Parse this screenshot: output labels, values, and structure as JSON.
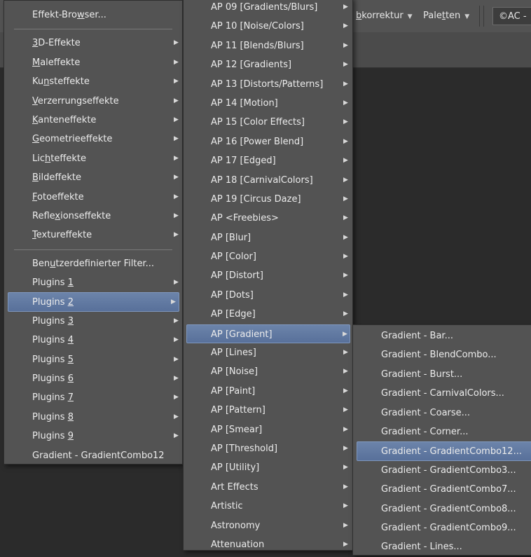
{
  "toolbar": {
    "farbkorrektur_prefix": "",
    "farbkorrektur_u": "b",
    "farbkorrektur_rest": "korrektur",
    "paletten_pre": "Pale",
    "paletten_u": "t",
    "paletten_rest": "ten",
    "copyright_box": "©AC -"
  },
  "menu1": {
    "items": [
      {
        "pre": "Effekt-Bro",
        "u": "w",
        "post": "ser...",
        "arrow": false
      },
      {
        "separator": true
      },
      {
        "pre": "",
        "u": "3",
        "post": "D-Effekte",
        "arrow": true
      },
      {
        "pre": "",
        "u": "M",
        "post": "aleffekte",
        "arrow": true
      },
      {
        "pre": "Ku",
        "u": "n",
        "post": "steffekte",
        "arrow": true
      },
      {
        "pre": "",
        "u": "V",
        "post": "erzerrungseffekte",
        "arrow": true
      },
      {
        "pre": "",
        "u": "K",
        "post": "anteneffekte",
        "arrow": true
      },
      {
        "pre": "",
        "u": "G",
        "post": "eometrieeffekte",
        "arrow": true
      },
      {
        "pre": "Lic",
        "u": "h",
        "post": "teffekte",
        "arrow": true
      },
      {
        "pre": "",
        "u": "B",
        "post": "ildeffekte",
        "arrow": true
      },
      {
        "pre": "",
        "u": "F",
        "post": "otoeffekte",
        "arrow": true
      },
      {
        "pre": "Refle",
        "u": "x",
        "post": "ionseffekte",
        "arrow": true
      },
      {
        "pre": "",
        "u": "T",
        "post": "extureffekte",
        "arrow": true
      },
      {
        "separator": true
      },
      {
        "pre": "Ben",
        "u": "u",
        "post": "tzerdefinierter Filter...",
        "arrow": false
      },
      {
        "pre": "Plugins ",
        "u": "1",
        "post": "",
        "arrow": true
      },
      {
        "pre": "Plugins ",
        "u": "2",
        "post": "",
        "arrow": true,
        "highlighted": true
      },
      {
        "pre": "Plugins ",
        "u": "3",
        "post": "",
        "arrow": true
      },
      {
        "pre": "Plugins ",
        "u": "4",
        "post": "",
        "arrow": true
      },
      {
        "pre": "Plugins ",
        "u": "5",
        "post": "",
        "arrow": true
      },
      {
        "pre": "Plugins ",
        "u": "6",
        "post": "",
        "arrow": true
      },
      {
        "pre": "Plugins ",
        "u": "7",
        "post": "",
        "arrow": true
      },
      {
        "pre": "Plugins ",
        "u": "8",
        "post": "",
        "arrow": true
      },
      {
        "pre": "Plugins ",
        "u": "9",
        "post": "",
        "arrow": true
      },
      {
        "pre": "Gradient - GradientCombo12",
        "u": "",
        "post": "",
        "arrow": false
      }
    ]
  },
  "menu2": {
    "items": [
      {
        "label": "AP 09 [Gradients/Blurs]",
        "arrow": true
      },
      {
        "label": "AP 10 [Noise/Colors]",
        "arrow": true
      },
      {
        "label": "AP 11 [Blends/Blurs]",
        "arrow": true
      },
      {
        "label": "AP 12 [Gradients]",
        "arrow": true
      },
      {
        "label": "AP 13 [Distorts/Patterns]",
        "arrow": true
      },
      {
        "label": "AP 14 [Motion]",
        "arrow": true
      },
      {
        "label": "AP 15 [Color Effects]",
        "arrow": true
      },
      {
        "label": "AP 16 [Power Blend]",
        "arrow": true
      },
      {
        "label": "AP 17 [Edged]",
        "arrow": true
      },
      {
        "label": "AP 18 [CarnivalColors]",
        "arrow": true
      },
      {
        "label": "AP 19 [Circus Daze]",
        "arrow": true
      },
      {
        "label": "AP <Freebies>",
        "arrow": true
      },
      {
        "label": "AP [Blur]",
        "arrow": true
      },
      {
        "label": "AP [Color]",
        "arrow": true
      },
      {
        "label": "AP [Distort]",
        "arrow": true
      },
      {
        "label": "AP [Dots]",
        "arrow": true
      },
      {
        "label": "AP [Edge]",
        "arrow": true
      },
      {
        "label": "AP [Gradient]",
        "arrow": true,
        "highlighted": true
      },
      {
        "label": "AP [Lines]",
        "arrow": true
      },
      {
        "label": "AP [Noise]",
        "arrow": true
      },
      {
        "label": "AP [Paint]",
        "arrow": true
      },
      {
        "label": "AP [Pattern]",
        "arrow": true
      },
      {
        "label": "AP [Smear]",
        "arrow": true
      },
      {
        "label": "AP [Threshold]",
        "arrow": true
      },
      {
        "label": "AP [Utility]",
        "arrow": true
      },
      {
        "label": "Art Effects",
        "arrow": true
      },
      {
        "label": "Artistic",
        "arrow": true
      },
      {
        "label": "Astronomy",
        "arrow": true
      },
      {
        "label": "Attenuation",
        "arrow": true
      }
    ]
  },
  "menu3": {
    "items": [
      {
        "label": "Gradient - Bar..."
      },
      {
        "label": "Gradient - BlendCombo..."
      },
      {
        "label": "Gradient - Burst..."
      },
      {
        "label": "Gradient - CarnivalColors..."
      },
      {
        "label": "Gradient - Coarse..."
      },
      {
        "label": "Gradient - Corner..."
      },
      {
        "label": "Gradient - GradientCombo12...",
        "highlighted": true
      },
      {
        "label": "Gradient - GradientCombo3..."
      },
      {
        "label": "Gradient - GradientCombo7..."
      },
      {
        "label": "Gradient - GradientCombo8..."
      },
      {
        "label": "Gradient - GradientCombo9..."
      },
      {
        "label": "Gradient - Lines..."
      }
    ]
  }
}
